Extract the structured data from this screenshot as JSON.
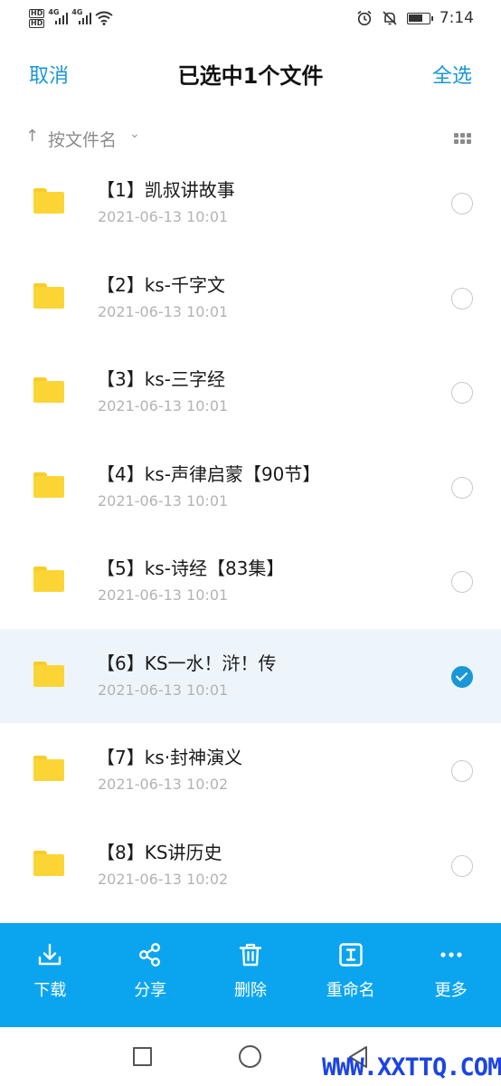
{
  "status_bar": {
    "hd1": "HD",
    "hd2": "HD",
    "net1": "4G",
    "net2": "4G",
    "time": "7:14",
    "battery_level": 0.7
  },
  "header": {
    "cancel": "取消",
    "title": "已选中1个文件",
    "select_all": "全选"
  },
  "sort": {
    "label": "按文件名"
  },
  "files": [
    {
      "name": "【1】凯叔讲故事",
      "date": "2021-06-13  10:01",
      "selected": false
    },
    {
      "name": "【2】ks-千字文",
      "date": "2021-06-13  10:01",
      "selected": false
    },
    {
      "name": "【3】ks-三字经",
      "date": "2021-06-13  10:01",
      "selected": false
    },
    {
      "name": "【4】ks-声律启蒙【90节】",
      "date": "2021-06-13  10:01",
      "selected": false
    },
    {
      "name": "【5】ks-诗经【83集】",
      "date": "2021-06-13  10:01",
      "selected": false
    },
    {
      "name": "【6】KS一水！浒！传",
      "date": "2021-06-13  10:01",
      "selected": true
    },
    {
      "name": "【7】ks·封神演义",
      "date": "2021-06-13  10:02",
      "selected": false
    },
    {
      "name": "【8】KS讲历史",
      "date": "2021-06-13  10:02",
      "selected": false
    }
  ],
  "actions": [
    {
      "label": "下载",
      "icon": "download-icon"
    },
    {
      "label": "分享",
      "icon": "share-icon"
    },
    {
      "label": "删除",
      "icon": "trash-icon"
    },
    {
      "label": "重命名",
      "icon": "rename-icon"
    },
    {
      "label": "更多",
      "icon": "more-icon"
    }
  ],
  "watermark": "WWW.XXTTQ.COM",
  "colors": {
    "accent": "#1a97d6",
    "action_bar": "#0ba5ef",
    "folder": "#fbd535",
    "selected_row": "#edf5fb",
    "watermark": "#1b44e3"
  }
}
